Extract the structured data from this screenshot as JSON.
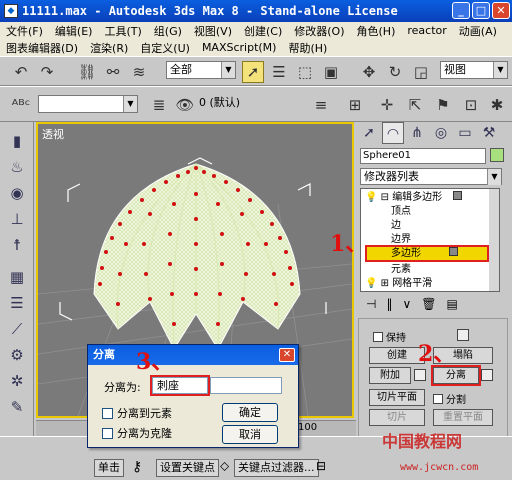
{
  "window": {
    "title": "11111.max - Autodesk 3ds Max 8 - Stand-alone License"
  },
  "menu": {
    "row1": [
      "文件(F)",
      "编辑(E)",
      "工具(T)",
      "组(G)",
      "视图(V)",
      "创建(C)",
      "修改器(O)",
      "角色(H)",
      "reactor",
      "动画(A)"
    ],
    "row2": [
      "图表编辑器(D)",
      "渲染(R)",
      "自定义(U)",
      "MAXScript(M)",
      "帮助(H)"
    ]
  },
  "toolbar": {
    "selection_filter": "全部",
    "view_dropdown": "视图",
    "layer": "0 (默认)"
  },
  "viewport": {
    "label": "透视"
  },
  "command_panel": {
    "object_name": "Sphere01",
    "modifier_list": "修改器列表",
    "stack": [
      {
        "label": "编辑多边形"
      },
      {
        "label": "顶点"
      },
      {
        "label": "边"
      },
      {
        "label": "边界"
      },
      {
        "label": "多边形"
      },
      {
        "label": "元素"
      },
      {
        "label": "网格平滑"
      }
    ],
    "rollout": {
      "preserve_label": "保持",
      "create_label": "创建",
      "collapse_label": "塌陷",
      "attach_label": "附加",
      "detach_label": "分离",
      "slice_plane_label": "切片平面",
      "split_label": "分割",
      "slice_label": "切片",
      "reset_plane_label": "重置平面"
    }
  },
  "annotations": {
    "a1": "1、",
    "a2": "2、",
    "a3": "3、"
  },
  "dialog": {
    "title": "分离",
    "detach_as_label": "分离为:",
    "detach_as_value": "刺座",
    "to_element_label": "分离到元素",
    "as_clone_label": "分离为克隆",
    "ok_label": "确定",
    "cancel_label": "取消"
  },
  "timeline": {
    "end_frame": "100"
  },
  "statusbar": {
    "single_label": "单击",
    "set_key_label": "设置关键点",
    "key_filter_label": "关键点过滤器..."
  },
  "watermark": {
    "text": "中国教程网",
    "url": "www.jcwcn.com"
  },
  "colors": {
    "highlight": "#f2d600",
    "annotation": "#e01010",
    "selected_tool": "#f4e27a"
  }
}
